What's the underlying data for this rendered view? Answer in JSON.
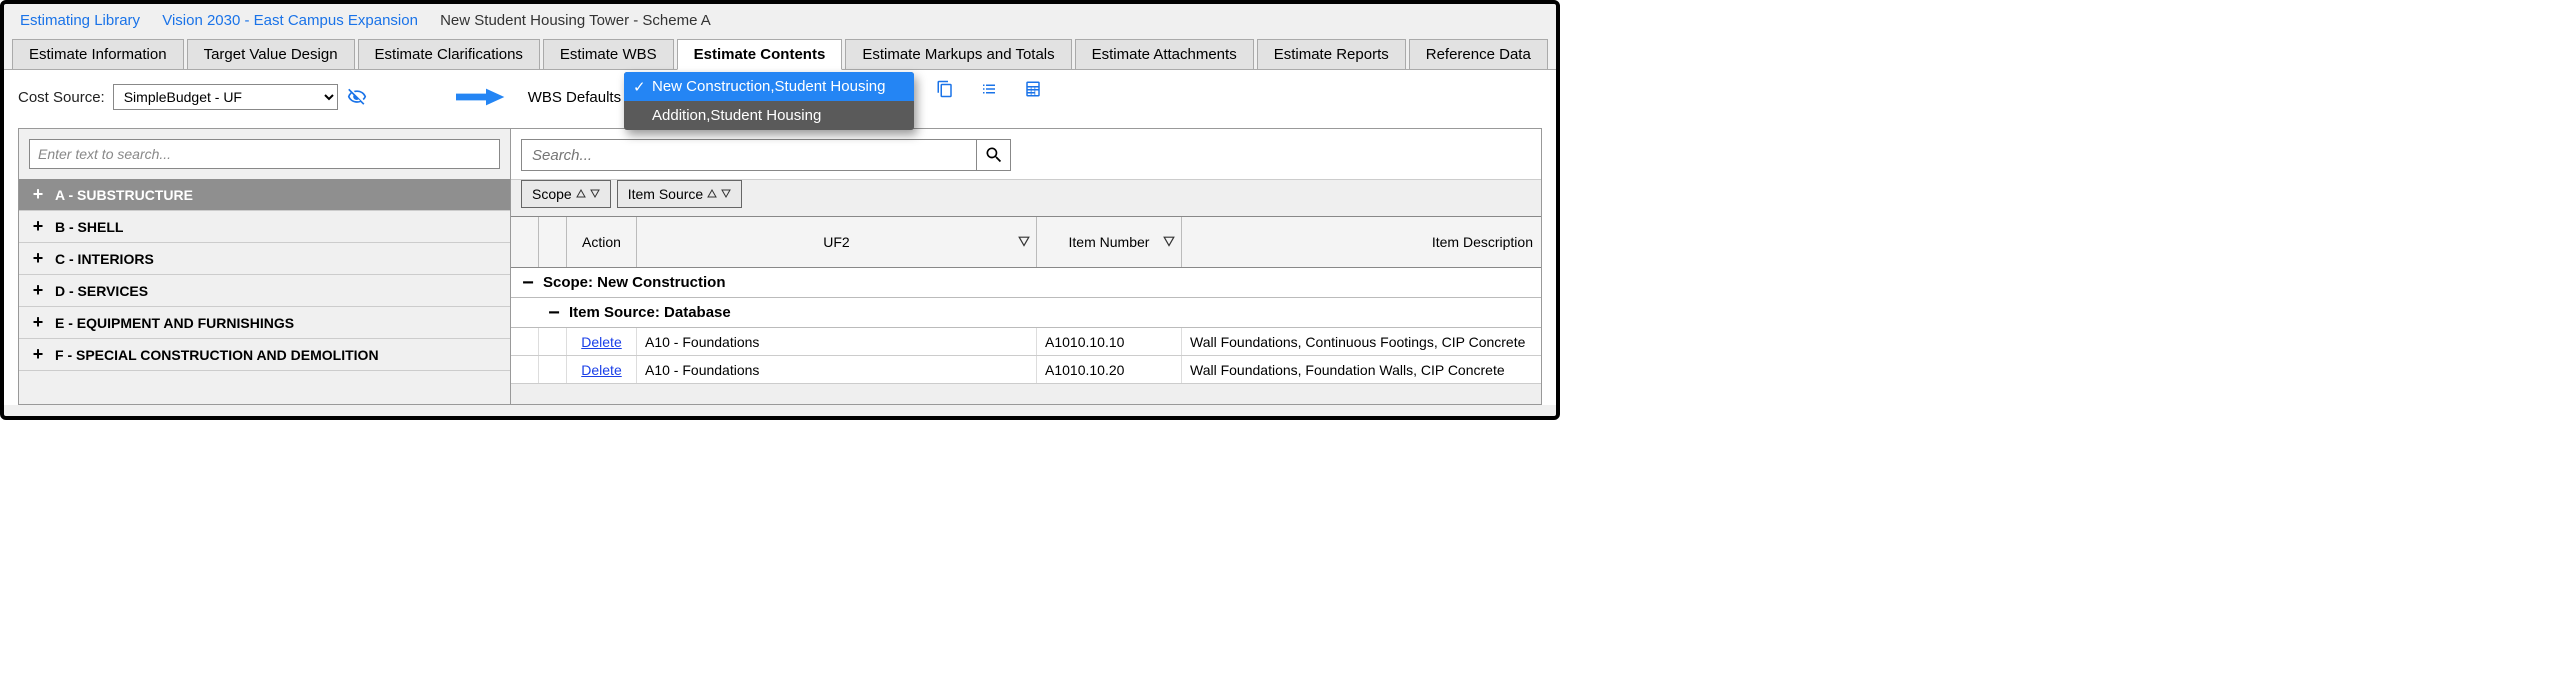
{
  "breadcrumb": {
    "lib": "Estimating Library",
    "project": "Vision 2030 - East Campus Expansion",
    "current": "New Student Housing Tower - Scheme A"
  },
  "tabs": [
    {
      "label": "Estimate Information"
    },
    {
      "label": "Target Value Design"
    },
    {
      "label": "Estimate Clarifications"
    },
    {
      "label": "Estimate WBS"
    },
    {
      "label": "Estimate Contents"
    },
    {
      "label": "Estimate Markups and Totals"
    },
    {
      "label": "Estimate Attachments"
    },
    {
      "label": "Estimate Reports"
    },
    {
      "label": "Reference Data"
    }
  ],
  "active_tab": 4,
  "toolbar": {
    "cost_source_label": "Cost Source:",
    "cost_source_value": "SimpleBudget - UF",
    "wbs_defaults_label": "WBS Defaults",
    "dropdown_options": [
      {
        "label": "New Construction,Student Housing",
        "selected": true
      },
      {
        "label": "Addition,Student Housing",
        "selected": false
      }
    ]
  },
  "left_panel": {
    "search_placeholder": "Enter text to search...",
    "tree": [
      {
        "label": "A - SUBSTRUCTURE",
        "selected": true
      },
      {
        "label": "B - SHELL"
      },
      {
        "label": "C - INTERIORS"
      },
      {
        "label": "D - SERVICES"
      },
      {
        "label": "E - EQUIPMENT AND FURNISHINGS"
      },
      {
        "label": "F - SPECIAL CONSTRUCTION AND DEMOLITION"
      }
    ]
  },
  "right_panel": {
    "search_placeholder": "Search...",
    "filter_buttons": {
      "scope": "Scope",
      "item_source": "Item Source"
    },
    "columns": {
      "action": "Action",
      "uf2": "UF2",
      "item_number": "Item Number",
      "item_description": "Item Description"
    },
    "group1_label": "Scope: New Construction",
    "group2_label": "Item Source: Database",
    "action_label": "Delete",
    "rows": [
      {
        "uf2": "A10 - Foundations",
        "item_number": "A1010.10.10",
        "desc": "Wall Foundations, Continuous Footings, CIP Concrete"
      },
      {
        "uf2": "A10 - Foundations",
        "item_number": "A1010.10.20",
        "desc": "Wall Foundations, Foundation Walls, CIP Concrete"
      }
    ]
  }
}
